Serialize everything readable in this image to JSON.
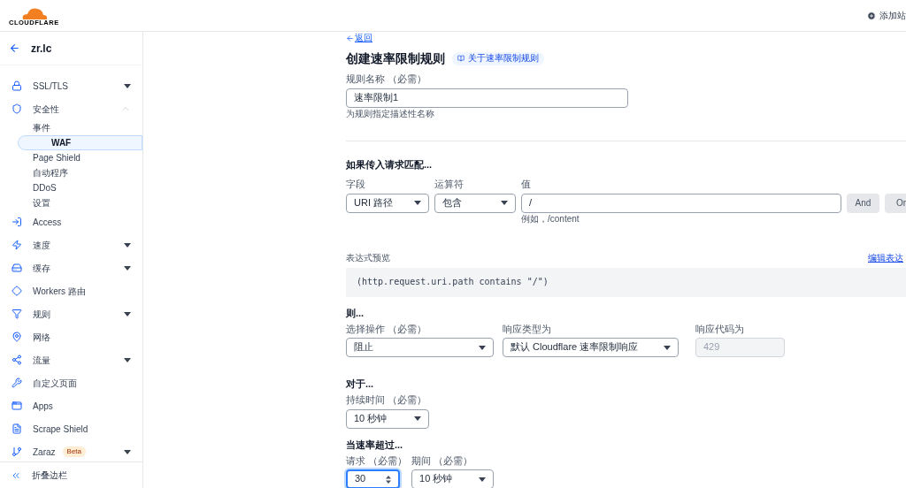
{
  "header": {
    "logo": "CLOUDFLARE",
    "add_site": "添加站"
  },
  "sidebar": {
    "site": "zr.lc",
    "items": [
      {
        "label": "SSL/TLS",
        "expanded": false,
        "selected": false
      },
      {
        "label": "安全性",
        "expanded": true,
        "selected": false,
        "children": [
          {
            "label": "事件",
            "selected": false
          },
          {
            "label": "WAF",
            "selected": true
          },
          {
            "label": "Page Shield",
            "selected": false
          },
          {
            "label": "自动程序",
            "selected": false
          },
          {
            "label": "DDoS",
            "selected": false
          },
          {
            "label": "设置",
            "selected": false
          }
        ]
      },
      {
        "label": "Access",
        "selected": false
      },
      {
        "label": "速度",
        "expanded": false,
        "selected": false
      },
      {
        "label": "缓存",
        "expanded": false,
        "selected": false
      },
      {
        "label": "Workers 路由",
        "selected": false
      },
      {
        "label": "规则",
        "expanded": false,
        "selected": false
      },
      {
        "label": "网络",
        "selected": false
      },
      {
        "label": "流量",
        "expanded": false,
        "selected": false
      },
      {
        "label": "自定义页面",
        "selected": false
      },
      {
        "label": "Apps",
        "selected": false
      },
      {
        "label": "Scrape Shield",
        "selected": false
      },
      {
        "label": "Zaraz",
        "badge": "Beta",
        "expanded": false,
        "selected": false
      }
    ],
    "collapse": "折叠边栏"
  },
  "main": {
    "back": "返回",
    "title": "创建速率限制规则",
    "doc_link": "关于速率限制规则",
    "name_field": {
      "label": "规则名称 （必需）",
      "value": "速率限制1",
      "hint": "为规则指定描述性名称"
    },
    "match": {
      "heading": "如果传入请求匹配...",
      "field": {
        "label": "字段",
        "value": "URI 路径"
      },
      "operator": {
        "label": "运算符",
        "value": "包含"
      },
      "value": {
        "label": "值",
        "value": "/",
        "hint": "例如，/content"
      },
      "buttons": [
        "And",
        "Or"
      ]
    },
    "preview": {
      "label": "表达式预览",
      "edit_link": "编辑表达",
      "expression": "(http.request.uri.path contains \"/\")"
    },
    "then": {
      "heading": "则...",
      "action": {
        "label": "选择操作 （必需）",
        "value": "阻止"
      },
      "response_type": {
        "label": "响应类型为",
        "value": "默认 Cloudflare 速率限制响应"
      },
      "response_code": {
        "label": "响应代码为",
        "value": "429",
        "disabled": true
      }
    },
    "for": {
      "heading": "对于...",
      "duration": {
        "label": "持续时间 （必需）",
        "value": "10 秒钟"
      }
    },
    "rate": {
      "heading": "当速率超过...",
      "requests": {
        "label": "请求 （必需）",
        "value": "30",
        "focused": true
      },
      "period": {
        "label": "期间 （必需）",
        "value": "10 秒钟"
      }
    }
  }
}
